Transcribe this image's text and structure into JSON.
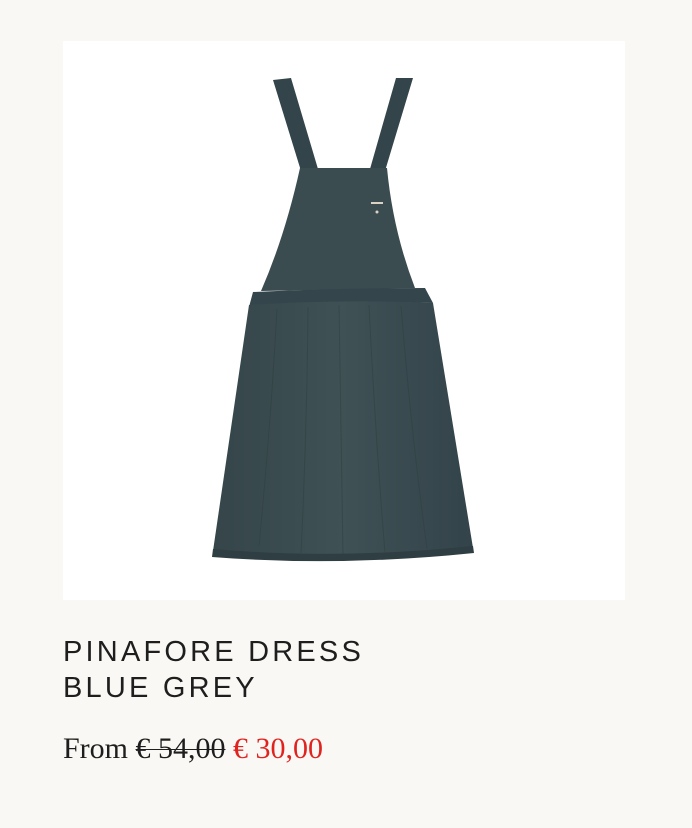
{
  "product": {
    "image_alt": "Pinafore dress blue grey",
    "title_lines": [
      "PINAFORE DRESS",
      "BLUE GREY"
    ],
    "price_prefix": "From",
    "old_price": "€ 54,00",
    "sale_price": "€ 30,00"
  },
  "colors": {
    "background": "#f9f8f4",
    "image_background": "#ffffff",
    "dress": "#3d4e52",
    "text": "#1e1e1e",
    "sale": "#e0231f"
  }
}
